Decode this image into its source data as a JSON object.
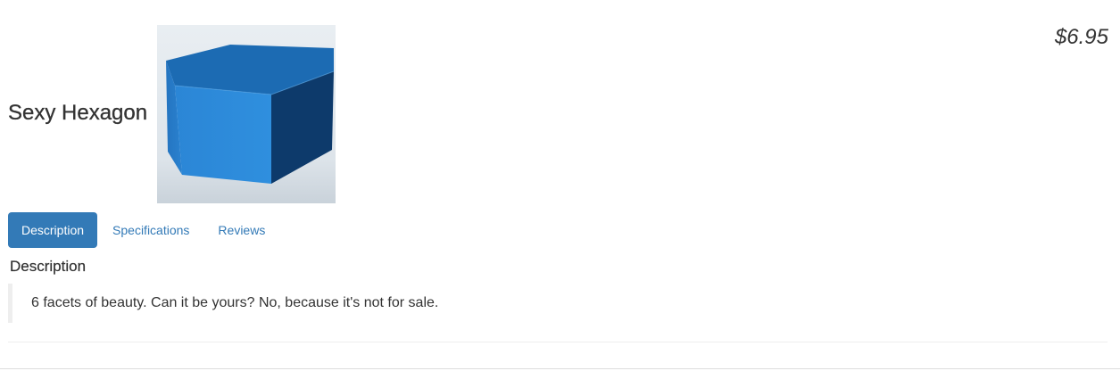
{
  "product": {
    "title": "Sexy Hexagon",
    "price": "$6.95",
    "image_alt": "Blue hexagonal prism"
  },
  "tabs": [
    {
      "label": "Description",
      "active": true
    },
    {
      "label": "Specifications",
      "active": false
    },
    {
      "label": "Reviews",
      "active": false
    }
  ],
  "description": {
    "heading": "Description",
    "text": "6 facets of beauty. Can it be yours? No, because it's not for sale."
  },
  "colors": {
    "accent": "#337ab7",
    "hexagon_top": "#1e6fb8",
    "hexagon_front": "#2d8ad8",
    "hexagon_side": "#0e3f73"
  }
}
